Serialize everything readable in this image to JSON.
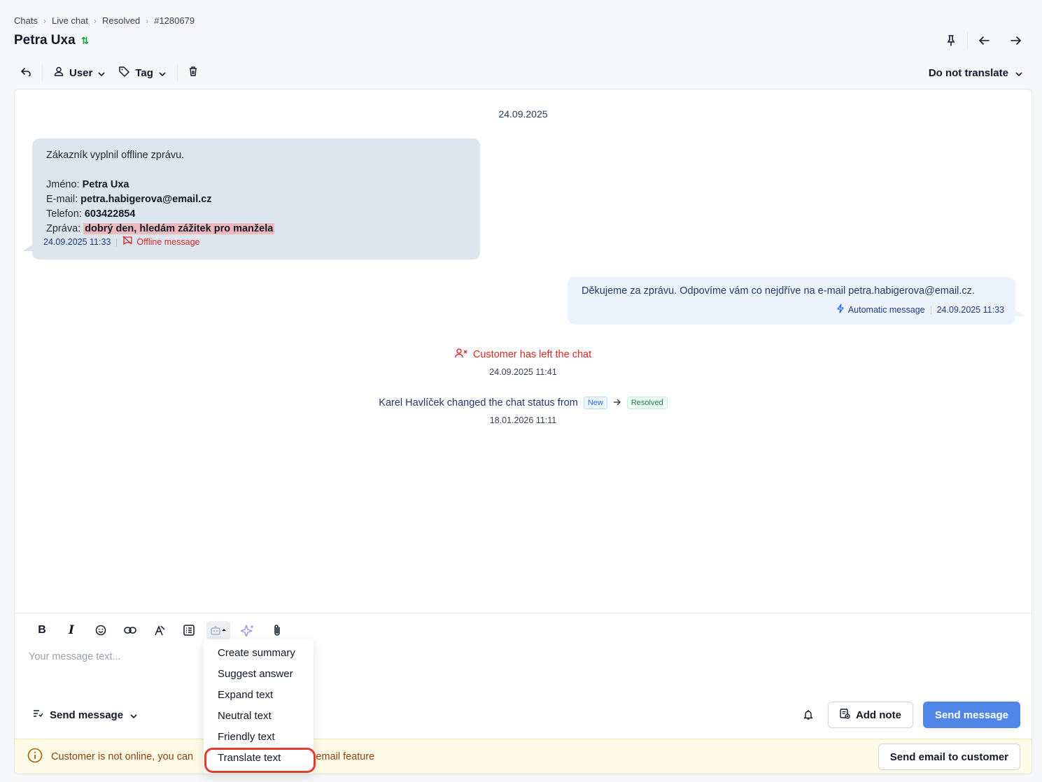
{
  "breadcrumb": [
    "Chats",
    "Live chat",
    "Resolved",
    "#1280679"
  ],
  "title": "Petra Uxa",
  "toolbar": {
    "user_label": "User",
    "tag_label": "Tag",
    "translate_label": "Do not translate"
  },
  "chat": {
    "date": "24.09.2025",
    "incoming": {
      "intro": "Zákazník vyplnil offline zprávu.",
      "name_label": "Jméno:",
      "name_value": "Petra Uxa",
      "email_label": "E-mail:",
      "email_value": "petra.habigerova@email.cz",
      "phone_label": "Telefon:",
      "phone_value": "603422854",
      "message_label": "Zpráva:",
      "message_value": "dobrý den, hledám zážitek pro manžela",
      "timestamp": "24.09.2025 11:33",
      "type": "Offline message"
    },
    "outgoing": {
      "text": "Děkujeme za zprávu. Odpovíme vám co nejdříve na e-mail petra.habigerova@email.cz.",
      "type": "Automatic message",
      "timestamp": "24.09.2025 11:33"
    },
    "left_event": {
      "text": "Customer has left the chat",
      "time": "24.09.2025 11:41"
    },
    "status_event": {
      "text": "Karel Havlíček changed the chat status from",
      "from": "New",
      "to": "Resolved",
      "time": "18.01.2026 11:11"
    }
  },
  "composer": {
    "placeholder": "Your message text...",
    "send_mode": "Send message",
    "add_note": "Add note",
    "send": "Send message"
  },
  "ai_menu": [
    "Create summary",
    "Suggest answer",
    "Expand text",
    "Neutral text",
    "Friendly text",
    "Translate text"
  ],
  "notice": {
    "text": "Customer is not online, you can",
    "text_tail": "ia email feature",
    "button": "Send email to customer"
  },
  "colors": {
    "accent": "#4f86e8",
    "incoming_bubble": "#dde5ee",
    "outgoing_bubble": "#edf3fb",
    "danger": "#dc2626",
    "highlight": "#efb9b9",
    "notice_bg": "#fefbe8",
    "menu_circle": "#e0402a"
  },
  "icons": {
    "undo": "undo-icon",
    "user": "user-icon",
    "tag": "tag-icon",
    "trash": "trash-icon",
    "pin": "pin-icon",
    "prev": "arrow-left-icon",
    "next": "arrow-right-icon",
    "bold": "bold-icon",
    "italic": "italic-icon",
    "emoji": "emoji-icon",
    "link": "link-icon",
    "clear_format": "clear-format-icon",
    "template": "template-icon",
    "ai": "ai-bot-icon",
    "sparkle": "sparkle-icon",
    "attach": "paperclip-icon",
    "bell": "bell-icon"
  }
}
